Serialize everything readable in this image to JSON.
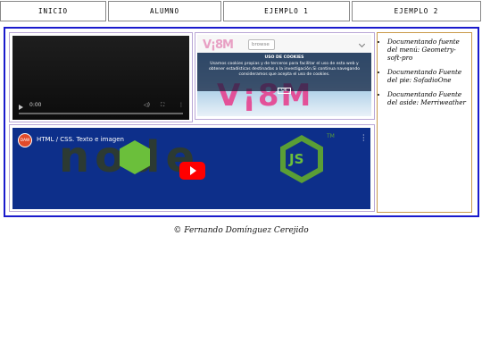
{
  "nav": {
    "items": [
      {
        "label": "INICIO"
      },
      {
        "label": "ALUMNO"
      },
      {
        "label": "EJEMPLO  1"
      },
      {
        "label": "EJEMPLO  2"
      }
    ]
  },
  "video": {
    "time": "0:00",
    "progress": 0
  },
  "cookie_page": {
    "logo": "V¡8M",
    "browse_label": "browse",
    "big_logo": "V¡8M",
    "notice_title": "USO DE COOKIES",
    "notice_text": "Usamos cookies propias y de terceros para facilitar el uso de esta web y obtener estadísticas destinadas a la investigación.Si continua navegando consideramos que acepta el uso de cookies.",
    "ok_label": "OK"
  },
  "youtube": {
    "channel_avatar": "DAW",
    "title": "HTML / CSS. Texto e imagen",
    "thumb_word": "node",
    "thumb_js": "JS",
    "thumb_tm": "TM",
    "colors": {
      "play": "#ff0000",
      "background": "#0d2f8a",
      "node_green": "#6bbf3b"
    }
  },
  "aside": {
    "items": [
      {
        "text": "Documentando fuente del menú: Geometry-soft-pro"
      },
      {
        "text": "Documentando Fuente del pie: SofadioOne"
      },
      {
        "text": "Documentando Fuente del aside: Merriweather"
      }
    ]
  },
  "footer": {
    "text": "© Fernando Domínguez Cerejido"
  },
  "colors": {
    "main_border": "#1a1acc",
    "aside_border": "#c99a4a",
    "pane_border": "#b9a7d6"
  }
}
